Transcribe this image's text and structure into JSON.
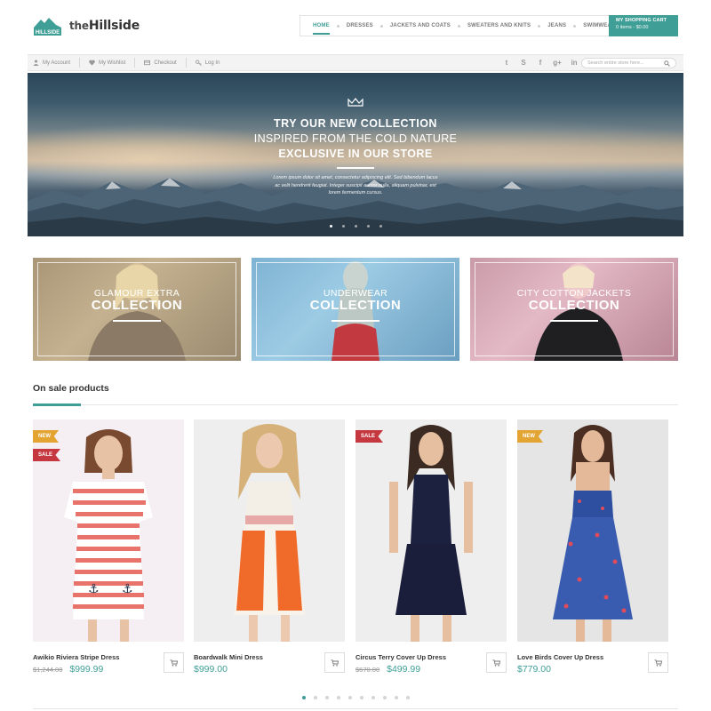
{
  "brand": {
    "badge_text": "HILLSIDE",
    "prefix": "the",
    "name": "Hillside",
    "accent_color": "#3f9e96"
  },
  "nav": {
    "items": [
      {
        "label": "HOME",
        "active": true
      },
      {
        "label": "DRESSES",
        "active": false
      },
      {
        "label": "JACKETS AND COATS",
        "active": false
      },
      {
        "label": "SWEATERS AND KNITS",
        "active": false
      },
      {
        "label": "JEANS",
        "active": false
      },
      {
        "label": "SWIMWEAR",
        "active": false
      }
    ]
  },
  "cart": {
    "title": "MY SHOPPING CART",
    "summary": "0 items - $0.00"
  },
  "util": {
    "links": [
      {
        "label": "My Account",
        "icon": "user-icon"
      },
      {
        "label": "My Wishlist",
        "icon": "heart-icon"
      },
      {
        "label": "Checkout",
        "icon": "checkout-icon"
      },
      {
        "label": "Log In",
        "icon": "key-icon"
      }
    ],
    "social": [
      {
        "glyph": "t",
        "icon": "twitter-icon"
      },
      {
        "glyph": "S",
        "icon": "skype-icon"
      },
      {
        "glyph": "f",
        "icon": "facebook-icon"
      },
      {
        "glyph": "g+",
        "icon": "google-plus-icon"
      },
      {
        "glyph": "in",
        "icon": "linkedin-icon"
      }
    ],
    "search_placeholder": "Search entire store here..."
  },
  "hero": {
    "line1": "TRY OUR NEW COLLECTION",
    "line2": "INSPIRED FROM THE COLD NATURE",
    "line3": "EXCLUSIVE IN OUR STORE",
    "body": "Lorem ipsum dolor sit amet, consectetur adipiscing elit. Sed bibendum lacus ac velit hendrerit feugiat. Integer suscipit auctor nulla, aliquam pulvinar, est lorem fermentum cursus.",
    "slides": 5,
    "active_slide": 0
  },
  "collections": [
    {
      "line1": "GLAMOUR EXTRA",
      "line2": "COLLECTION"
    },
    {
      "line1": "UNDERWEAR",
      "line2": "COLLECTION"
    },
    {
      "line1": "CITY COTTON JACKETS",
      "line2": "COLLECTION"
    }
  ],
  "on_sale": {
    "title": "On sale products",
    "products": [
      {
        "name": "Awikio Riviera Stripe Dress",
        "old_price": "$1,244.00",
        "price": "$999.99",
        "badges": [
          "NEW",
          "SALE"
        ]
      },
      {
        "name": "Boardwalk Mini Dress",
        "old_price": "",
        "price": "$999.00",
        "badges": []
      },
      {
        "name": "Circus Terry Cover Up Dress",
        "old_price": "$670.00",
        "price": "$499.99",
        "badges": [
          "SALE"
        ]
      },
      {
        "name": "Love Birds Cover Up Dress",
        "old_price": "",
        "price": "$779.00",
        "badges": [
          "NEW"
        ]
      }
    ],
    "pages": 10,
    "active_page": 0
  },
  "colors": {
    "badge_new": "#e3a432",
    "badge_sale": "#c6383f",
    "price": "#3f9e96"
  }
}
